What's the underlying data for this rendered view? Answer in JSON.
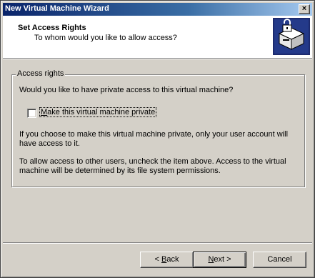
{
  "window": {
    "title": "New Virtual Machine Wizard",
    "close_glyph": "×"
  },
  "header": {
    "title": "Set Access Rights",
    "subtitle": "To whom would you like to allow access?",
    "icon": "virtual-machine-lock-icon"
  },
  "group": {
    "legend": "Access rights",
    "question": "Would you like to have private access to this virtual machine?",
    "checkbox": {
      "label": "Make this virtual machine private",
      "checked": false
    },
    "paragraph1": "If you choose to make this virtual machine private, only your user account will have access to it.",
    "paragraph2": "To allow access to other users, uncheck the item above. Access to the virtual machine will be determined by its file system permissions."
  },
  "buttons": {
    "back": {
      "mnemonic": "B",
      "rest": "ack",
      "prefix": "< "
    },
    "next": {
      "mnemonic": "N",
      "rest": "ext",
      "suffix": " >"
    },
    "cancel": "Cancel"
  },
  "colors": {
    "titlebar_start": "#0a246a",
    "titlebar_end": "#a6caf0",
    "face": "#d4d0c8"
  }
}
